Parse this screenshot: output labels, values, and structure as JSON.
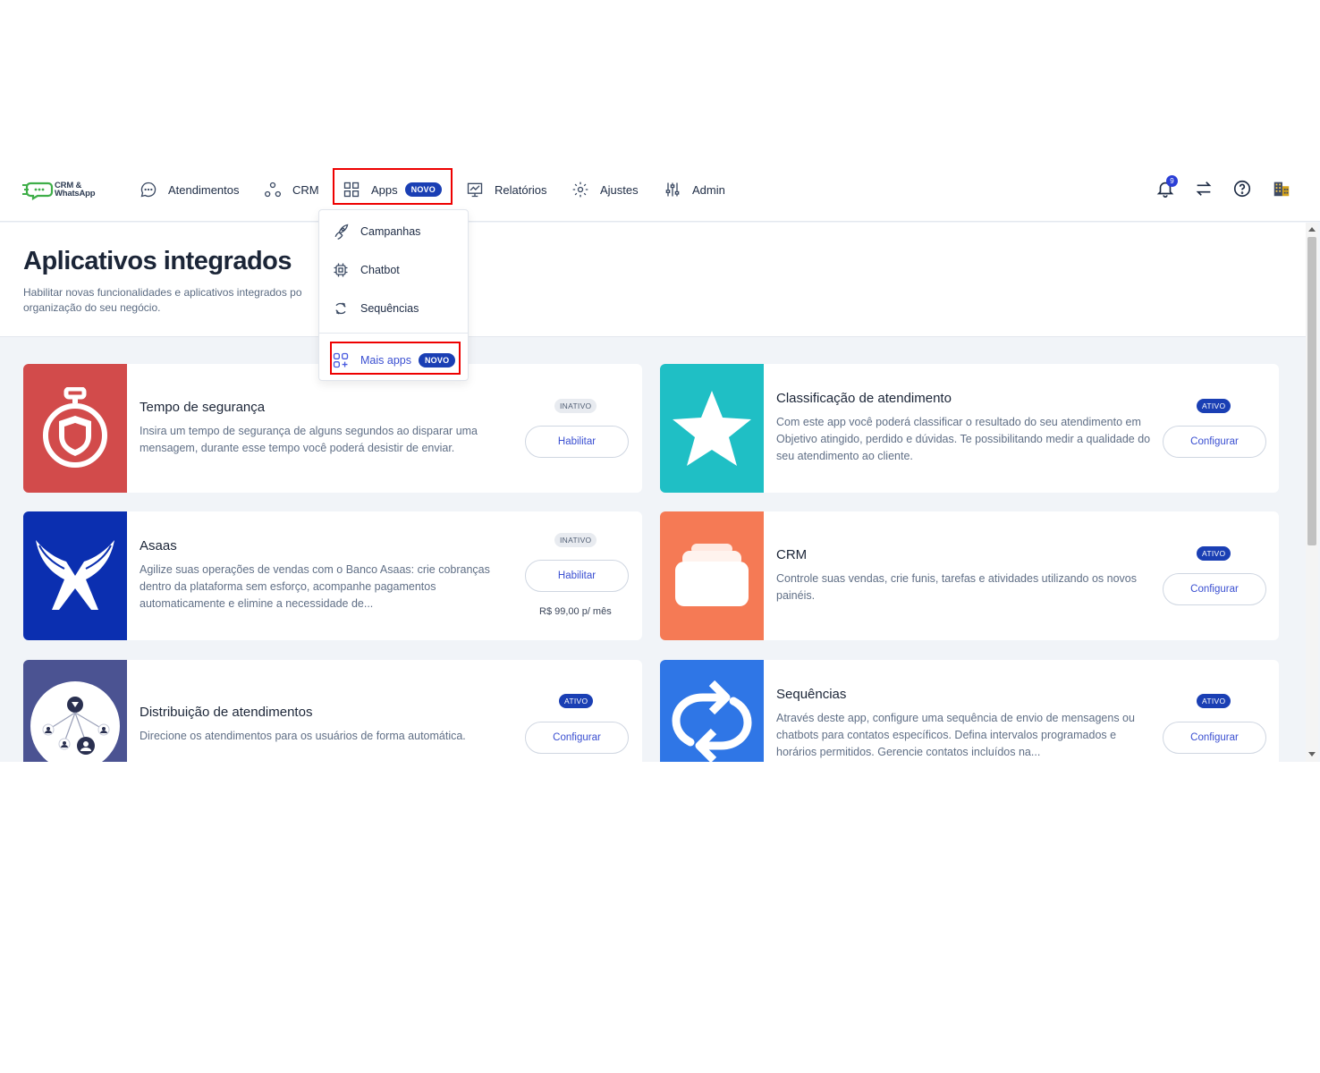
{
  "nav": {
    "logo_line1": "CRM &",
    "logo_line2": "WhatsApp",
    "atendimentos": "Atendimentos",
    "crm": "CRM",
    "apps": "Apps",
    "apps_badge": "NOVO",
    "relatorios": "Relatórios",
    "ajustes": "Ajustes",
    "admin": "Admin",
    "notification_count": "9"
  },
  "dropdown": {
    "campanhas": "Campanhas",
    "chatbot": "Chatbot",
    "sequencias": "Sequências",
    "mais_apps": "Mais apps",
    "mais_apps_badge": "NOVO"
  },
  "page": {
    "title": "Aplicativos integrados",
    "subtitle_line1": "Habilitar novas funcionalidades e aplicativos integrados po",
    "subtitle_line2": "organização do seu negócio."
  },
  "cards": [
    {
      "title": "Tempo de segurança",
      "description": "Insira um tempo de segurança de alguns segundos ao disparar uma mensagem, durante esse tempo você poderá desistir de enviar.",
      "status": "INATIVO",
      "button": "Habilitar",
      "color": "#d24b4b"
    },
    {
      "title": "Classificação de atendimento",
      "description": "Com este app você poderá classificar o resultado do seu atendimento em Objetivo atingido, perdido e dúvidas. Te possibilitando medir a qualidade do seu atendimento ao cliente.",
      "status": "ATIVO",
      "button": "Configurar",
      "color": "#1fbfc5"
    },
    {
      "title": "Asaas",
      "description": "Agilize suas operações de vendas com o Banco Asaas: crie cobranças dentro da plataforma sem esforço, acompanhe pagamentos automaticamente e elimine a necessidade de...",
      "status": "INATIVO",
      "button": "Habilitar",
      "price": "R$ 99,00 p/ mês",
      "color": "#0b2fb0"
    },
    {
      "title": "CRM",
      "description": "Controle suas vendas, crie funis, tarefas e atividades utilizando os novos painéis.",
      "status": "ATIVO",
      "button": "Configurar",
      "color": "#f57a55"
    },
    {
      "title": "Distribuição de atendimentos",
      "description": "Direcione os atendimentos para os usuários de forma automática.",
      "status": "ATIVO",
      "button": "Configurar",
      "color": "#4b5392"
    },
    {
      "title": "Sequências",
      "description": "Através deste app, configure uma sequência de envio de mensagens ou chatbots para contatos específicos. Defina intervalos programados e horários permitidos. Gerencie contatos incluídos na...",
      "status": "ATIVO",
      "button": "Configurar",
      "color": "#2f76e6"
    }
  ],
  "colors": {
    "accent": "#1a3fb4",
    "link": "#3a4fd1",
    "highlight": "#e00000"
  }
}
